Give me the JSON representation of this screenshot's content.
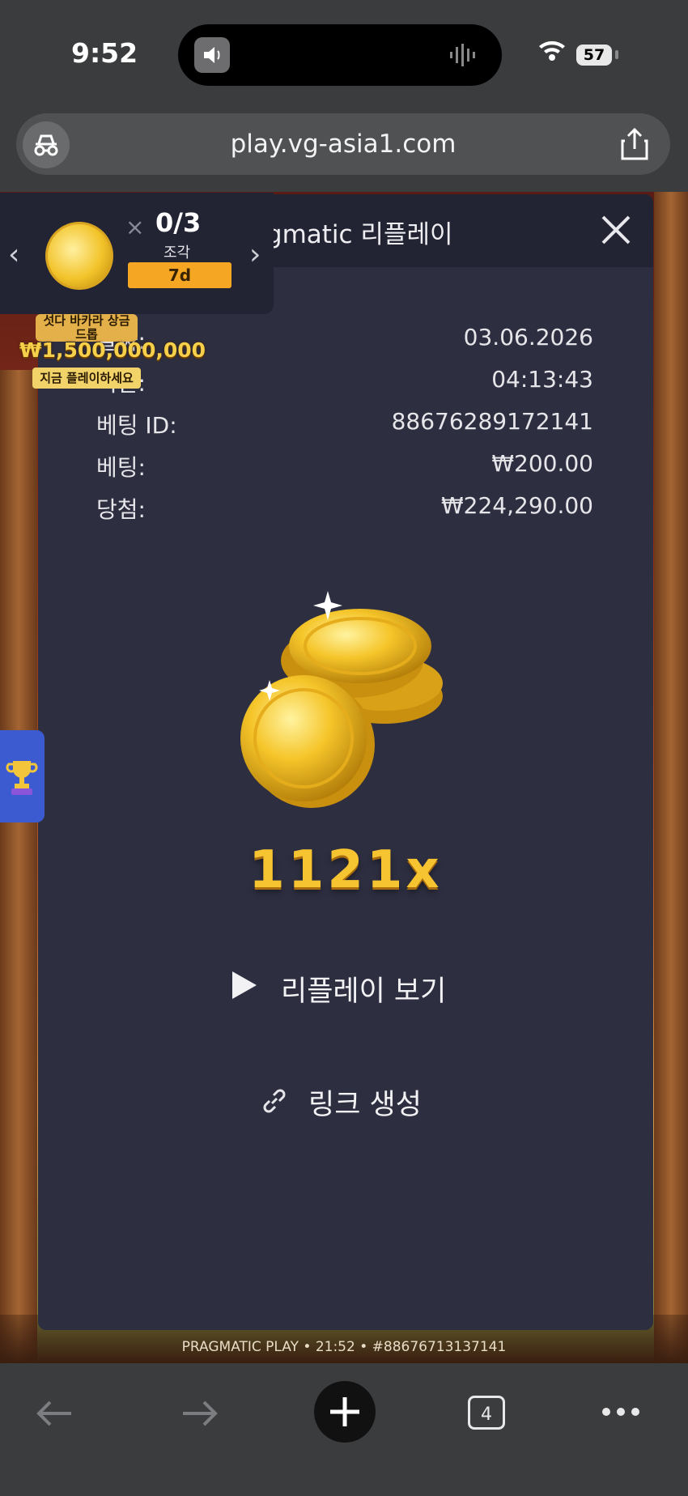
{
  "status_bar": {
    "time": "9:52",
    "battery": "57"
  },
  "browser": {
    "url": "play.vg-asia1.com",
    "tab_count": "4"
  },
  "modal": {
    "title": "Pragmatic 리플레이",
    "rows": [
      {
        "label": "날짜:",
        "value": "03.06.2026"
      },
      {
        "label": "시간:",
        "value": "04:13:43"
      },
      {
        "label": "베팅 ID:",
        "value": "88676289172141"
      },
      {
        "label": "베팅:",
        "value": "₩200.00"
      },
      {
        "label": "당첨:",
        "value": "₩224,290.00"
      }
    ],
    "multiplier": "1121x",
    "replay_label": "리플레이 보기",
    "link_label": "링크 생성"
  },
  "promo": {
    "count": "0/3",
    "count_sub": "조각",
    "timer": "7d",
    "banner_line1": "섯다 바카라 상금 드롭",
    "banner_amount": "₩1,500,000,000",
    "banner_cta": "지금 플레이하세요"
  },
  "game_footer": "PRAGMATIC PLAY • 21:52 • #88676713137141",
  "colors": {
    "accent_gold": "#f6c431",
    "modal_bg": "#2d2e40",
    "timer_orange": "#f5a623"
  }
}
